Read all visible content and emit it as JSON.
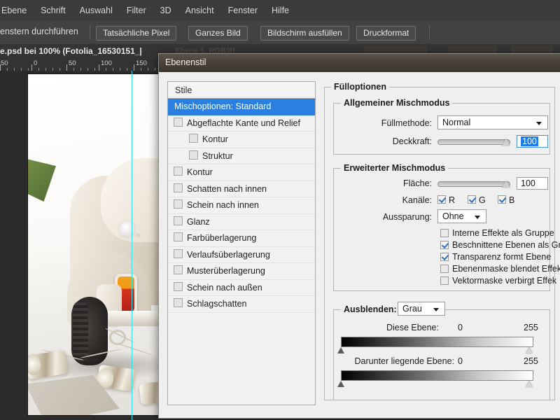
{
  "app": {
    "menubar": [
      "Ebene",
      "Schrift",
      "Auswahl",
      "Filter",
      "3D",
      "Ansicht",
      "Fenster",
      "Hilfe"
    ],
    "options_bar": {
      "left_label": "enstern durchführen",
      "buttons": [
        "Tatsächliche Pixel",
        "Ganzes Bild",
        "Bildschirm ausfüllen",
        "Druckformat"
      ]
    },
    "document_tab": {
      "title": "e.psd bei 100% (Fotolia_16530151_|",
      "ghost_title": "Ebene 1, RGB/8)"
    },
    "ruler": {
      "labels": [
        "50",
        "0",
        "50",
        "100",
        "150"
      ]
    }
  },
  "dialog": {
    "title": "Ebenenstil",
    "styles_panel": {
      "header": "Stile",
      "items": [
        {
          "label": "Mischoptionen: Standard",
          "selected": true,
          "checkbox": false,
          "indent": false
        },
        {
          "label": "Abgeflachte Kante und Relief",
          "selected": false,
          "checkbox": true,
          "checked": false,
          "indent": false
        },
        {
          "label": "Kontur",
          "selected": false,
          "checkbox": true,
          "checked": false,
          "indent": true
        },
        {
          "label": "Struktur",
          "selected": false,
          "checkbox": true,
          "checked": false,
          "indent": true
        },
        {
          "label": "Kontur",
          "selected": false,
          "checkbox": true,
          "checked": false,
          "indent": false
        },
        {
          "label": "Schatten nach innen",
          "selected": false,
          "checkbox": true,
          "checked": false,
          "indent": false
        },
        {
          "label": "Schein nach innen",
          "selected": false,
          "checkbox": true,
          "checked": false,
          "indent": false
        },
        {
          "label": "Glanz",
          "selected": false,
          "checkbox": true,
          "checked": false,
          "indent": false
        },
        {
          "label": "Farbüberlagerung",
          "selected": false,
          "checkbox": true,
          "checked": false,
          "indent": false
        },
        {
          "label": "Verlaufsüberlagerung",
          "selected": false,
          "checkbox": true,
          "checked": false,
          "indent": false
        },
        {
          "label": "Musterüberlagerung",
          "selected": false,
          "checkbox": true,
          "checked": false,
          "indent": false
        },
        {
          "label": "Schein nach außen",
          "selected": false,
          "checkbox": true,
          "checked": false,
          "indent": false
        },
        {
          "label": "Schlagschatten",
          "selected": false,
          "checkbox": true,
          "checked": false,
          "indent": false
        }
      ]
    },
    "fill_options": {
      "legend": "Fülloptionen",
      "general_blending": {
        "legend": "Allgemeiner Mischmodus",
        "blend_mode_label": "Füllmethode:",
        "blend_mode_value": "Normal",
        "opacity_label": "Deckkraft:",
        "opacity_value": "100"
      },
      "advanced_blending": {
        "legend": "Erweiterter Mischmodus",
        "fill_label": "Fläche:",
        "fill_value": "100",
        "channels_label": "Kanäle:",
        "channels": [
          {
            "label": "R",
            "checked": true
          },
          {
            "label": "G",
            "checked": true
          },
          {
            "label": "B",
            "checked": true
          }
        ],
        "knockout_label": "Aussparung:",
        "knockout_value": "Ohne",
        "checkboxes": [
          {
            "label": "Interne Effekte als Gruppe",
            "checked": false
          },
          {
            "label": "Beschnittene Ebenen als Gr",
            "checked": true
          },
          {
            "label": "Transparenz formt Ebene",
            "checked": true
          },
          {
            "label": "Ebenenmaske blendet Effek",
            "checked": false
          },
          {
            "label": "Vektormaske verbirgt Effek",
            "checked": false
          }
        ]
      },
      "blend_if": {
        "legend_label": "Ausblenden:",
        "legend_value": "Grau",
        "this_layer_label": "Diese Ebene:",
        "this_layer_min": "0",
        "this_layer_max": "255",
        "underlying_layer_label": "Darunter liegende Ebene:",
        "underlying_layer_min": "0",
        "underlying_layer_max": "255"
      }
    }
  },
  "colors": {
    "accent_selection": "#2a7fe0",
    "dialog_bg": "#efefef",
    "app_bg": "#2b2b2b",
    "guide": "#35e0ee"
  }
}
